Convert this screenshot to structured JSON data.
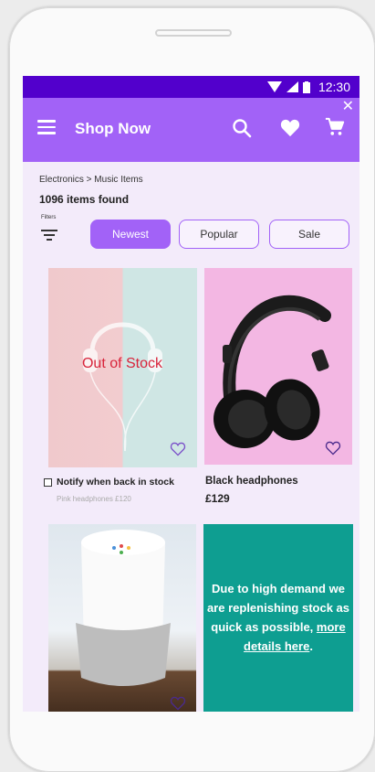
{
  "status_bar": {
    "time": "12:30"
  },
  "app_bar": {
    "title": "Shop Now"
  },
  "breadcrumb": "Electronics > Music Items",
  "results": {
    "count_text": "1096 items found"
  },
  "filters": {
    "label": "Filters",
    "chips": [
      {
        "label": "Newest",
        "active": true
      },
      {
        "label": "Popular",
        "active": false
      },
      {
        "label": "Sale",
        "active": false
      }
    ]
  },
  "products": [
    {
      "overlay": "Out of  Stock",
      "notify_label": "Notify when back in stock",
      "note": "Pink headphones  £120"
    },
    {
      "name": "Black headphones",
      "price": "£129"
    },
    {}
  ],
  "promo": {
    "text_before": "Due to high demand we are replenishing stock as quick as possible, ",
    "link_text": "more details here",
    "text_after": "."
  },
  "colors": {
    "status_bar": "#5200cc",
    "app_bar": "#a262f7",
    "background": "#f3ebfa",
    "promo": "#0e9e91",
    "out_of_stock": "#d8243b"
  }
}
